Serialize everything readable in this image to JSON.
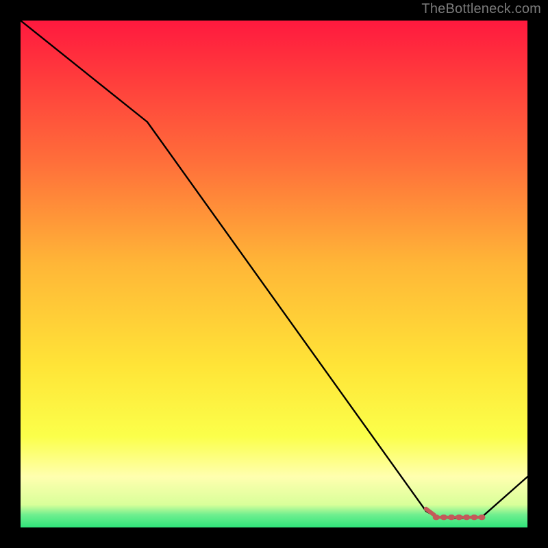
{
  "attribution": "TheBottleneck.com",
  "colors": {
    "background": "#000000",
    "line": "#000000",
    "marker": "#c35a5a",
    "gradient_top": "#ff193e",
    "gradient_mid_upper": "#ff913a",
    "gradient_mid": "#ffe437",
    "gradient_lower": "#f4ff52",
    "gradient_band": "#ffffaf",
    "gradient_green": "#2fe47a"
  },
  "chart_data": {
    "type": "line",
    "title": "",
    "xlabel": "",
    "ylabel": "",
    "xlim": [
      0,
      100
    ],
    "ylim": [
      0,
      100
    ],
    "grid": false,
    "legend": false,
    "x": [
      0,
      5,
      25,
      80,
      82,
      83.5,
      85,
      86,
      87,
      88,
      89,
      90,
      91,
      100
    ],
    "values": [
      100,
      96,
      80,
      3.2,
      2.1,
      1.9,
      1.8,
      1.8,
      1.8,
      1.9,
      1.9,
      2.0,
      2.05,
      10
    ],
    "marker_range_x": [
      82,
      91
    ],
    "marker_y": 2,
    "annotations": []
  }
}
